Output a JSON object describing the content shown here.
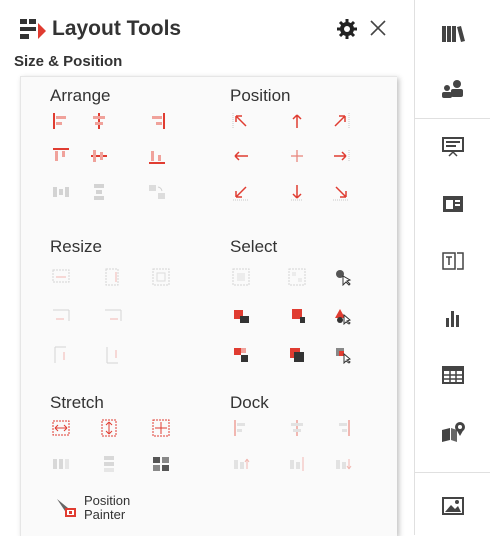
{
  "header": {
    "title": "Layout Tools",
    "icon": "layout-tools-icon",
    "gear_icon": "gear-icon",
    "close_icon": "close-icon"
  },
  "section": {
    "title": "Size & Position"
  },
  "groups": {
    "arrange": "Arrange",
    "position": "Position",
    "resize": "Resize",
    "select": "Select",
    "stretch": "Stretch",
    "dock": "Dock"
  },
  "painter": {
    "line1": "Position",
    "line2": "Painter"
  },
  "colors": {
    "accent": "#e03c31",
    "disabled": "#cfcfcf",
    "text": "#333333"
  }
}
